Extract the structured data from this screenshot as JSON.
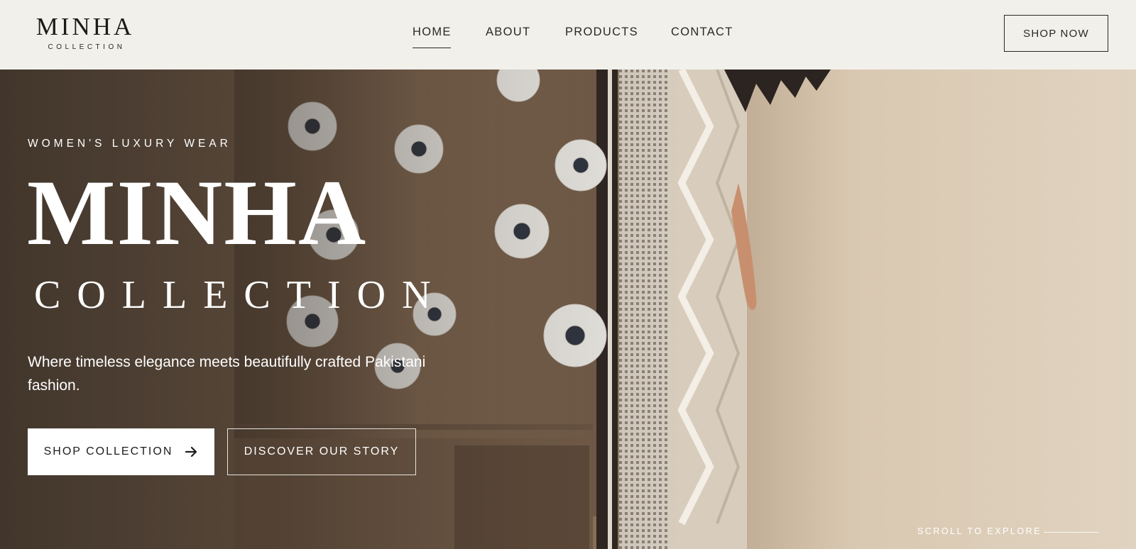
{
  "header": {
    "logo": {
      "main": "MINHA",
      "sub": "COLLECTION"
    },
    "nav": [
      {
        "label": "HOME",
        "active": true
      },
      {
        "label": "ABOUT"
      },
      {
        "label": "PRODUCTS"
      },
      {
        "label": "CONTACT"
      }
    ],
    "cta_label": "SHOP NOW"
  },
  "hero": {
    "eyebrow": "WOMEN'S LUXURY WEAR",
    "title": "MINHA",
    "subtitle": "COLLECTION",
    "tagline": "Where timeless elegance meets beautifully crafted Pakistani fashion.",
    "primary_button": "SHOP COLLECTION",
    "primary_button_icon": "arrow-right-icon",
    "secondary_button": "DISCOVER OUR STORY",
    "scroll_hint": "SCROLL TO EXPLORE"
  },
  "colors": {
    "header_bg": "#f2f0eb",
    "text_dark": "#2a2825",
    "hero_text": "#ffffff",
    "fabric_brown": "#8a7159",
    "backdrop_beige": "#d9c8b1"
  }
}
